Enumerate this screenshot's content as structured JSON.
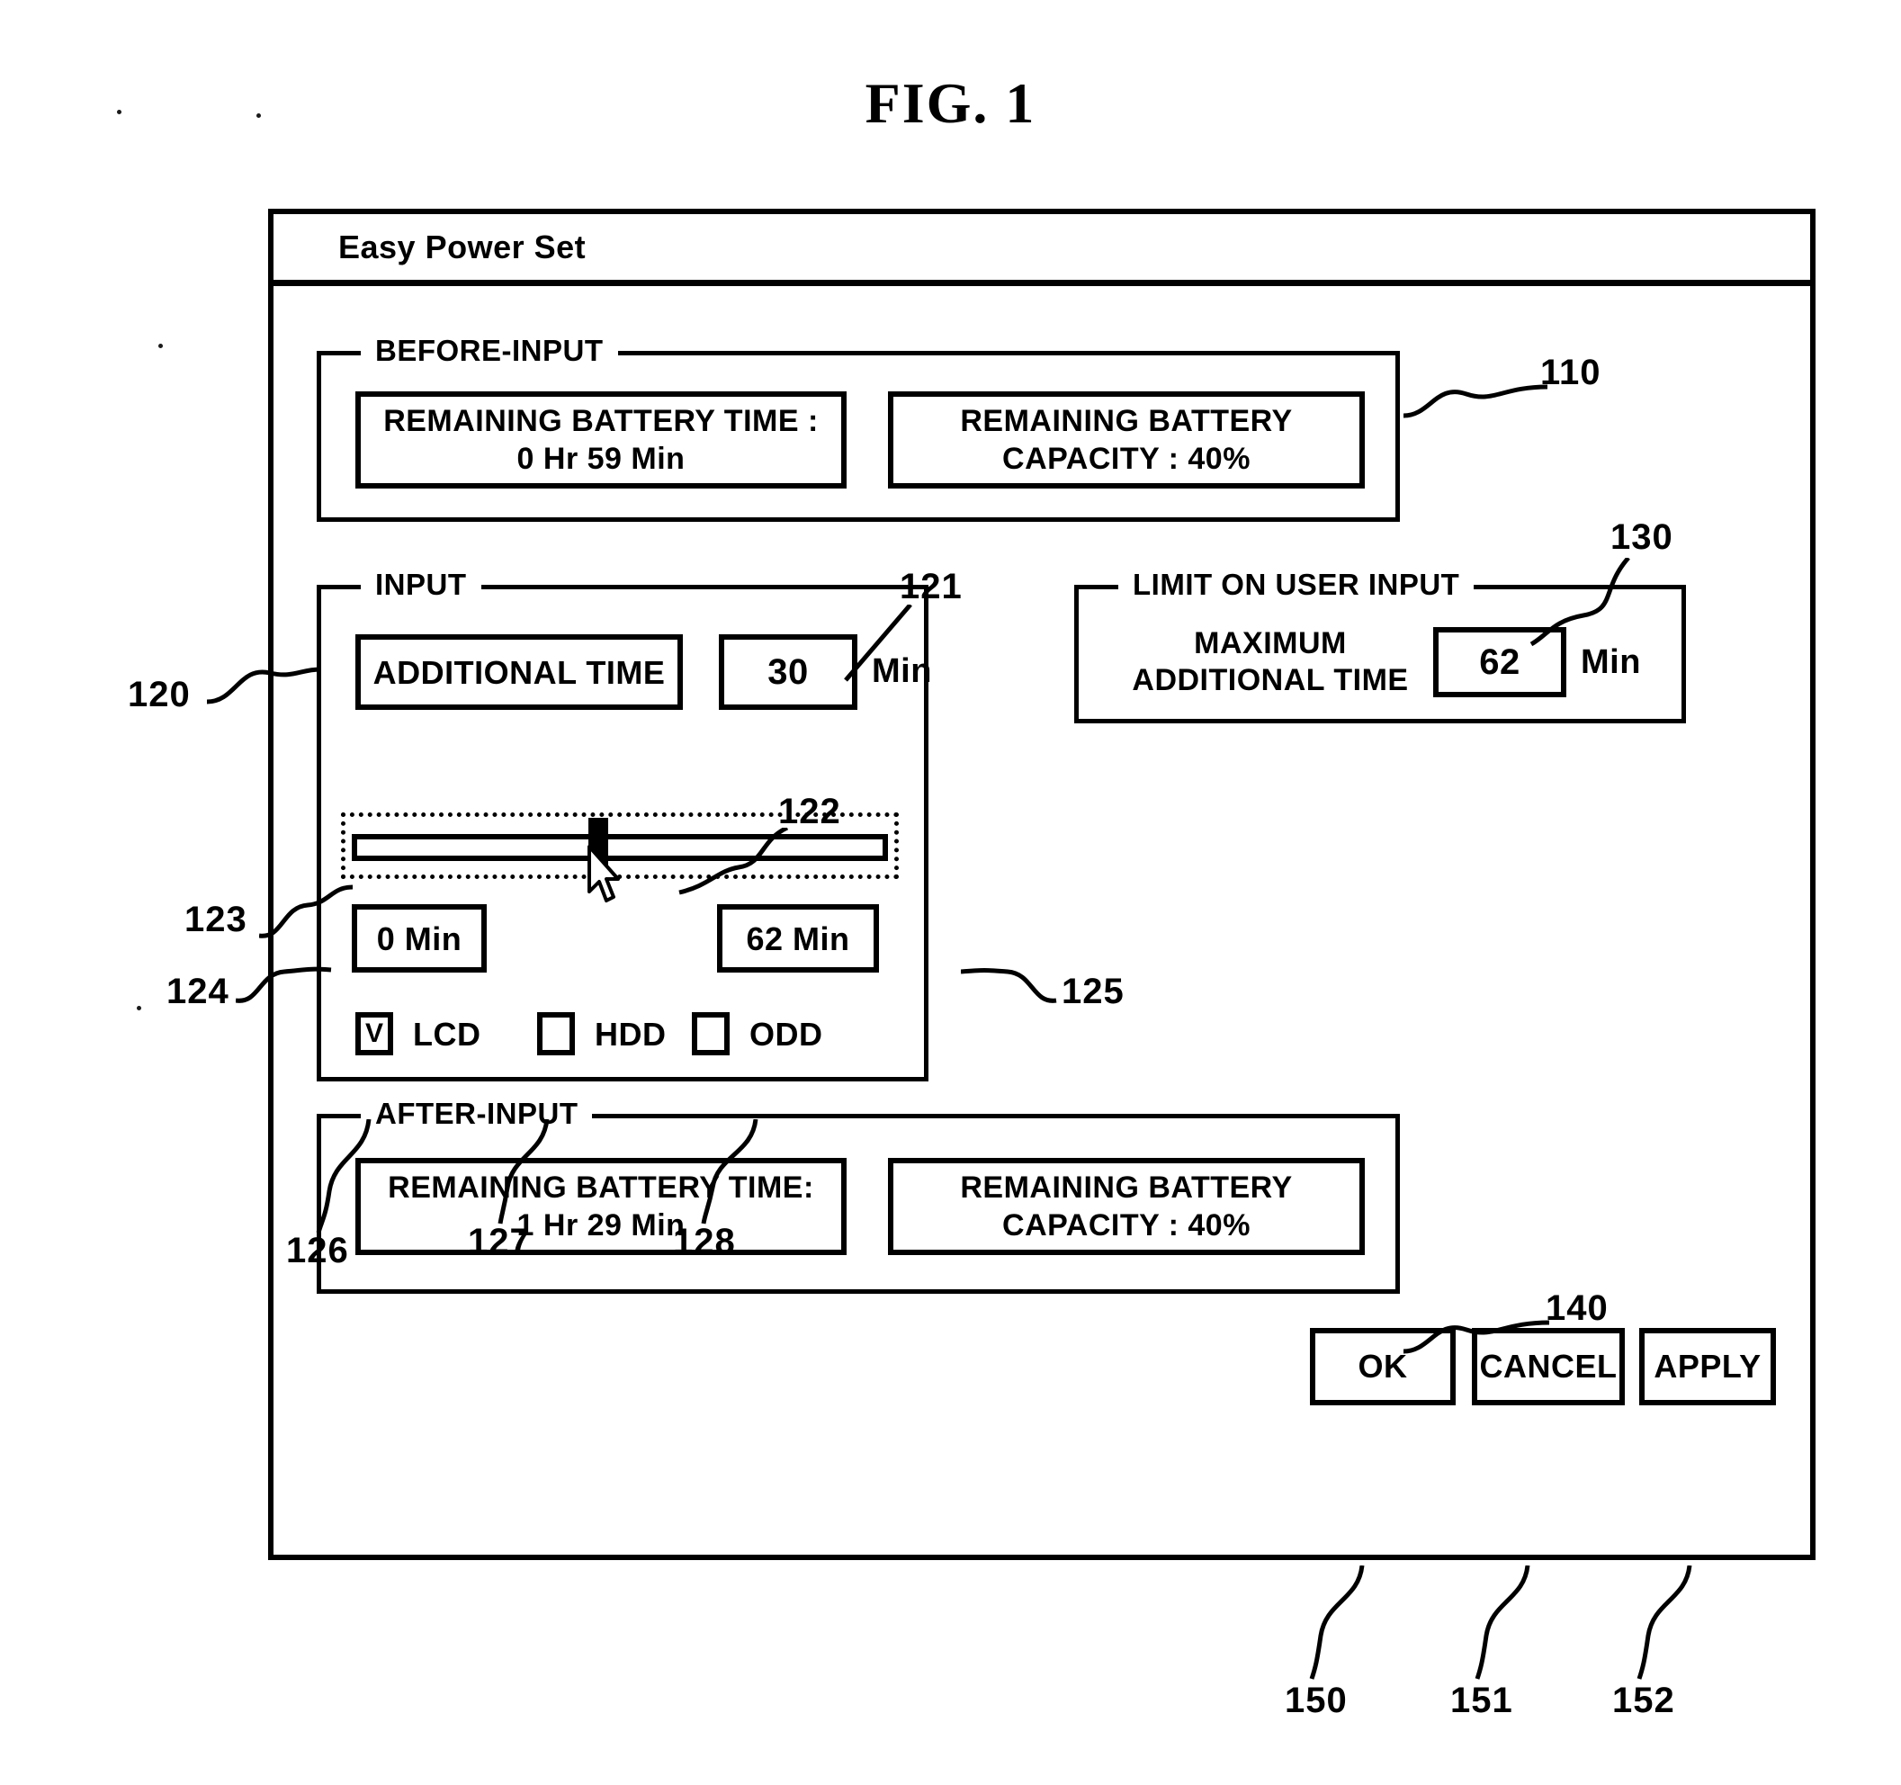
{
  "figure": {
    "title": "FIG. 1"
  },
  "window": {
    "title": "Easy Power Set"
  },
  "before_input": {
    "legend": "BEFORE-INPUT",
    "battery_time": {
      "label": "REMAINING BATTERY TIME :",
      "value": "0 Hr 59 Min"
    },
    "battery_capacity": {
      "label": "REMAINING BATTERY",
      "value": "CAPACITY : 40%"
    }
  },
  "input": {
    "legend": "INPUT",
    "additional_time_label": "ADDITIONAL TIME",
    "additional_time_value": "30",
    "additional_time_unit": "Min",
    "slider_min_label": "0 Min",
    "slider_max_label": "62 Min",
    "slider_value_percent": 48,
    "checkboxes": [
      {
        "label": "LCD",
        "checked": true,
        "mark": "V"
      },
      {
        "label": "HDD",
        "checked": false,
        "mark": ""
      },
      {
        "label": "ODD",
        "checked": false,
        "mark": ""
      }
    ]
  },
  "limit_on_user_input": {
    "legend": "LIMIT ON USER INPUT",
    "max_additional_time_label_line1": "MAXIMUM",
    "max_additional_time_label_line2": "ADDITIONAL TIME",
    "max_additional_time_value": "62",
    "max_additional_time_unit": "Min"
  },
  "after_input": {
    "legend": "AFTER-INPUT",
    "battery_time": {
      "label": "REMAINING BATTERY TIME:",
      "value": "1 Hr 29 Min"
    },
    "battery_capacity": {
      "label": "REMAINING BATTERY",
      "value": "CAPACITY : 40%"
    }
  },
  "buttons": {
    "ok": "OK",
    "cancel": "CANCEL",
    "apply": "APPLY"
  },
  "ref_numerals": {
    "before_input_group": "110",
    "input_group": "120",
    "additional_time_value_box": "121",
    "slider_thumb": "122",
    "slider_track": "123",
    "slider_min_box": "124",
    "slider_max_box": "125",
    "checkbox_lcd": "126",
    "checkbox_hdd": "127",
    "checkbox_odd": "128",
    "limit_group": "130",
    "after_input_group": "140",
    "ok_button": "150",
    "cancel_button": "151",
    "apply_button": "152"
  }
}
